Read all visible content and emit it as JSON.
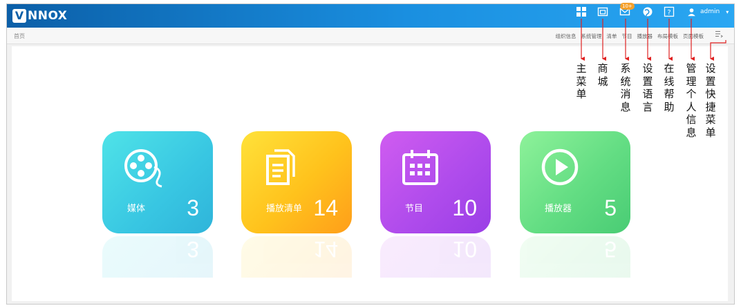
{
  "app": {
    "logo_mark": "V",
    "logo_text": "NNOX"
  },
  "header": {
    "icons": [
      "main-menu-icon",
      "store-icon",
      "mail-icon",
      "globe-icon",
      "help-icon",
      "user-icon"
    ],
    "badge": "10+",
    "user_name": "admin",
    "caret": "▾"
  },
  "breadcrumb": "首页",
  "quick_menu": [
    "组织信息",
    "系统管理",
    "清单",
    "节目",
    "播放器",
    "布局模板",
    "页面模板"
  ],
  "cards": [
    {
      "label": "媒体",
      "count": "3",
      "icon": "film-reel-icon"
    },
    {
      "label": "播放清单",
      "count": "14",
      "icon": "documents-icon"
    },
    {
      "label": "节目",
      "count": "10",
      "icon": "calendar-icon"
    },
    {
      "label": "播放器",
      "count": "5",
      "icon": "play-icon"
    }
  ],
  "annotations": [
    "主菜单",
    "商城",
    "系统消息",
    "设置语言",
    "在线帮助",
    "管理个人信息",
    "设置快捷菜单"
  ],
  "colors": {
    "header_start": "#0b5fa8",
    "header_end": "#2aa7f2",
    "arrow": "#e02020",
    "badge": "#f5a02a"
  }
}
